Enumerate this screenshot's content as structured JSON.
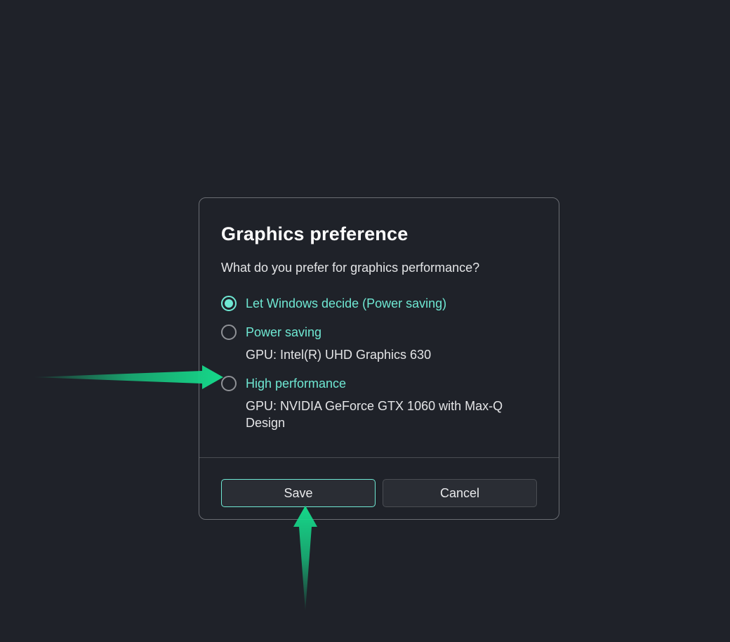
{
  "dialog": {
    "title": "Graphics preference",
    "question": "What do you prefer for graphics performance?",
    "options": [
      {
        "label": "Let Windows decide (Power saving)",
        "sub": ""
      },
      {
        "label": "Power saving",
        "sub": "GPU: Intel(R) UHD Graphics 630"
      },
      {
        "label": "High performance",
        "sub": "GPU: NVIDIA GeForce GTX 1060 with Max-Q Design"
      }
    ],
    "buttons": {
      "save": "Save",
      "cancel": "Cancel"
    }
  }
}
